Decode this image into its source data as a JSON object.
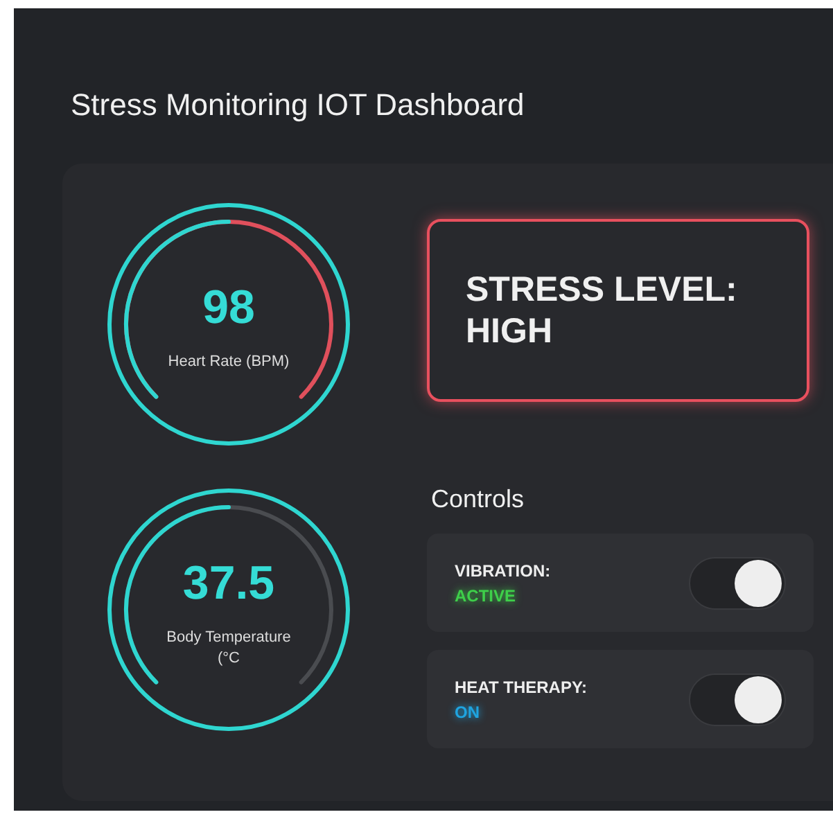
{
  "title": "Stress Monitoring IOT Dashboard",
  "gauges": [
    {
      "value": "98",
      "label": "Heart Rate (BPM)",
      "level": 0.5,
      "alert": true
    },
    {
      "value": "37.5",
      "label": "Body Temperature (°C",
      "level": 0.5,
      "alert": false
    }
  ],
  "stress": {
    "text": "STRESS LEVEL: HIGH",
    "alert": true
  },
  "controls_heading": "Controls",
  "controls": [
    {
      "name": "VIBRATION:",
      "status": "ACTIVE",
      "color": "#3ecf4a",
      "on": true
    },
    {
      "name": "HEAT THERAPY:",
      "status": "ON",
      "color": "#1fa4e0",
      "on": true
    }
  ]
}
